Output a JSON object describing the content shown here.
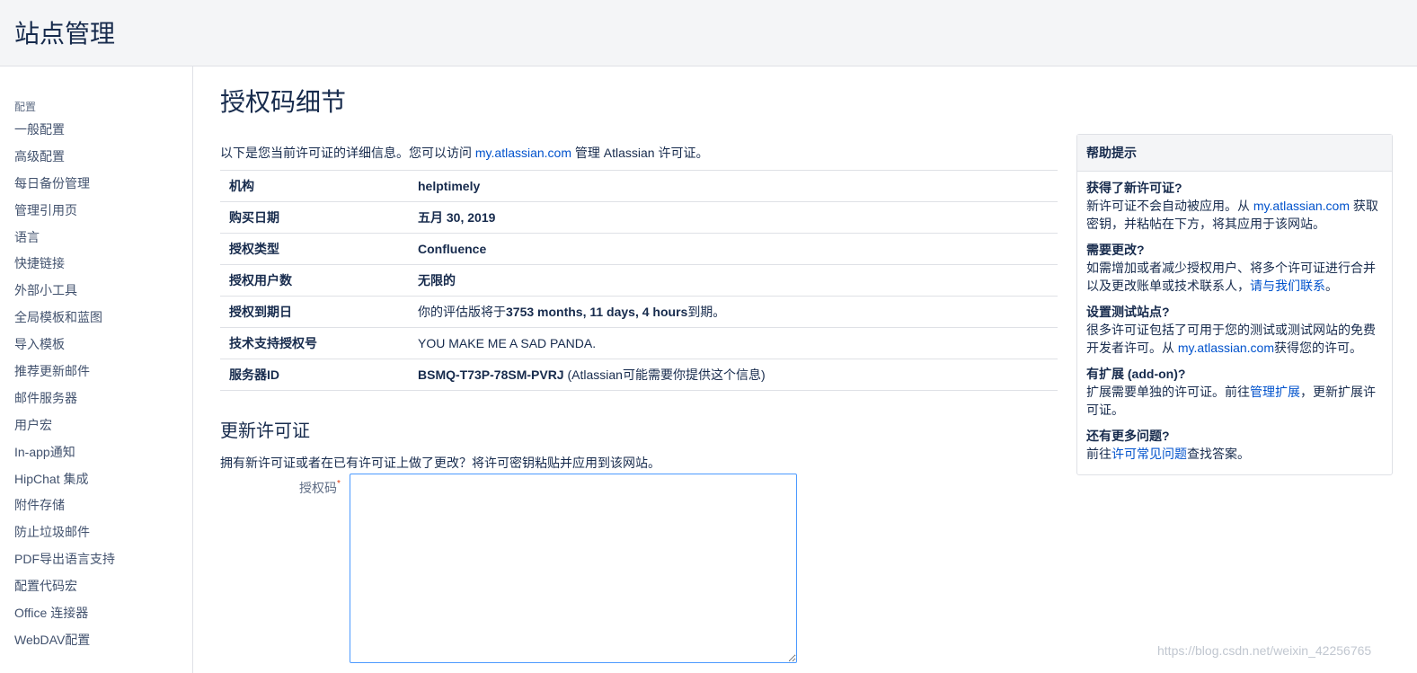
{
  "header": {
    "title": "站点管理"
  },
  "sidebar": {
    "section": "配置",
    "items": [
      "一般配置",
      "高级配置",
      "每日备份管理",
      "管理引用页",
      "语言",
      "快捷链接",
      "外部小工具",
      "全局模板和蓝图",
      "导入模板",
      "推荐更新邮件",
      "邮件服务器",
      "用户宏",
      "In-app通知",
      "HipChat 集成",
      "附件存储",
      "防止垃圾邮件",
      "PDF导出语言支持",
      "配置代码宏",
      "Office 连接器",
      "WebDAV配置"
    ]
  },
  "main": {
    "title": "授权码细节",
    "intro": {
      "before": "以下是您当前许可证的详细信息。您可以访问 ",
      "link": "my.atlassian.com",
      "after": " 管理 Atlassian 许可证。"
    },
    "rows": [
      {
        "key": "机构",
        "value": "helptimely"
      },
      {
        "key": "购买日期",
        "value": "五月 30, 2019"
      },
      {
        "key": "授权类型",
        "value": "Confluence"
      },
      {
        "key": "授权用户数",
        "value": "无限的"
      },
      {
        "key": "授权到期日",
        "pre": "你的评估版将于",
        "bold": "3753 months, 11 days, 4 hours",
        "post": "到期。"
      },
      {
        "key": "技术支持授权号",
        "value": "YOU MAKE ME A SAD PANDA."
      },
      {
        "key": "服务器ID",
        "bold": "BSMQ-T73P-78SM-PVRJ",
        "post": " (Atlassian可能需要你提供这个信息)"
      }
    ],
    "renew": {
      "title": "更新许可证",
      "desc": "拥有新许可证或者在已有许可证上做了更改？将许可密钥粘贴并应用到该网站。",
      "field_label": "授权码",
      "required_mark": "*",
      "value": ""
    }
  },
  "help": {
    "title": "帮助提示",
    "tips": [
      {
        "q": "获得了新许可证?",
        "pre": "新许可证不会自动被应用。从 ",
        "link": "my.atlassian.com",
        "post": " 获取密钥，并粘帖在下方，将其应用于该网站。"
      },
      {
        "q": "需要更改?",
        "pre": "如需增加或者减少授权用户、将多个许可证进行合并以及更改账单或技术联系人，",
        "link": "请与我们联系",
        "post": "。"
      },
      {
        "q": "设置测试站点?",
        "pre": "很多许可证包括了可用于您的测试或测试网站的免费开发者许可。从 ",
        "link": "my.atlassian.com",
        "post": "获得您的许可。"
      },
      {
        "q": "有扩展 (add-on)?",
        "pre": "扩展需要单独的许可证。前往",
        "link": "管理扩展",
        "post": "，更新扩展许可证。"
      },
      {
        "q": "还有更多问题?",
        "pre": "前往",
        "link": "许可常见问题",
        "post": "查找答案。"
      }
    ]
  },
  "watermark": "https://blog.csdn.net/weixin_42256765"
}
